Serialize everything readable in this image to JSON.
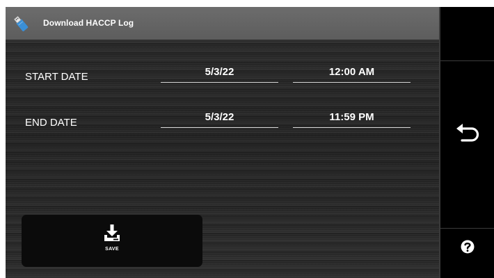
{
  "header": {
    "title": "Download HACCP Log",
    "icon": "usb-drive-icon"
  },
  "rows": [
    {
      "label": "START DATE",
      "date": "5/3/22",
      "time": "12:00 AM"
    },
    {
      "label": "END DATE",
      "date": "5/3/22",
      "time": "11:59 PM"
    }
  ],
  "save_button": {
    "label": "SAVE",
    "icon": "download-icon"
  },
  "sidebar": {
    "back_icon": "back-arrow-icon",
    "help_icon": "help-icon"
  },
  "colors": {
    "titlebar": "#5d5d5d",
    "background": "#262626",
    "sidebar": "#000000",
    "usb_blue": "#3a8fd6"
  }
}
